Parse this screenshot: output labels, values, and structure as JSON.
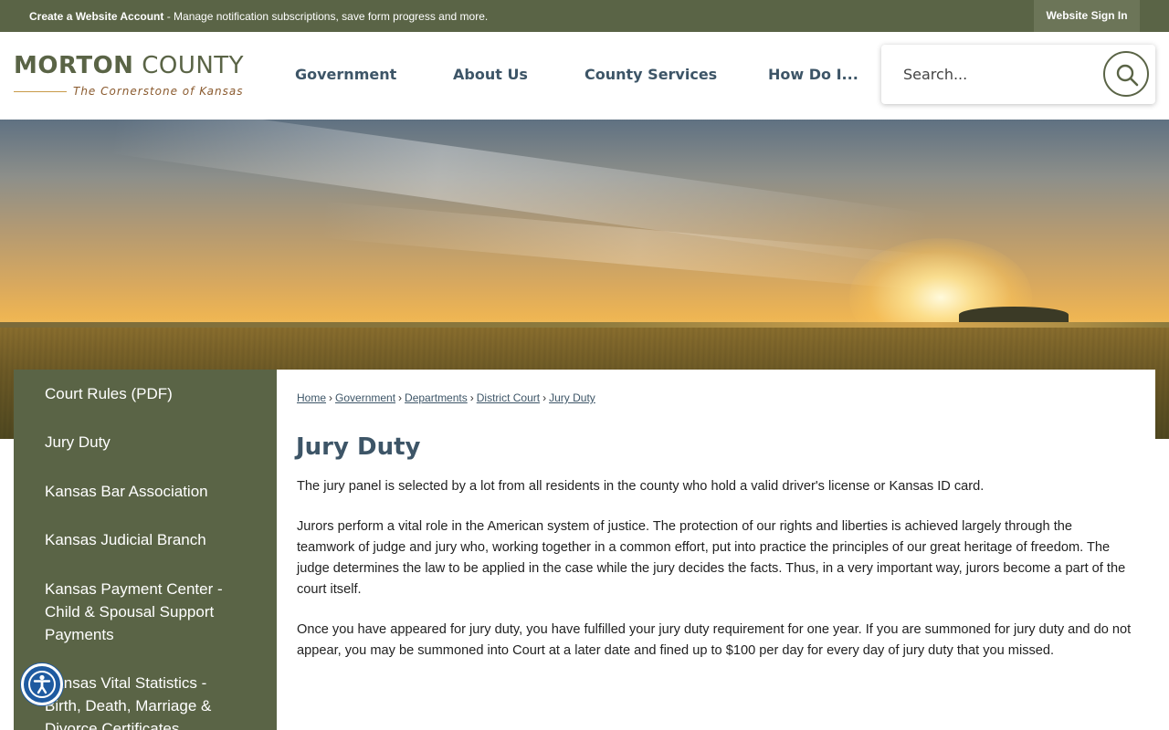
{
  "topbar": {
    "create_account_link": "Create a Website Account",
    "message": " - Manage notification subscriptions, save form progress and more.",
    "sign_in": "Website Sign In"
  },
  "header": {
    "logo_bold": "MORTON",
    "logo_rest": " COUNTY",
    "logo_tagline": "The Cornerstone of Kansas",
    "nav": [
      "Government",
      "About Us",
      "County Services",
      "How Do I..."
    ],
    "search_placeholder": "Search..."
  },
  "sidebar": {
    "items": [
      "Court Rules (PDF)",
      "Jury Duty",
      "Kansas Bar Association",
      "Kansas Judicial Branch",
      "Kansas Payment Center - Child & Spousal Support Payments",
      "Kansas Vital Statistics - Birth, Death, Marriage & Divorce Certificates"
    ]
  },
  "breadcrumb": [
    "Home",
    "Government",
    "Departments",
    "District Court",
    "Jury Duty"
  ],
  "main": {
    "title": "Jury Duty",
    "paragraphs": [
      "The jury panel is selected by a lot from all residents in the county who hold a valid driver's license or Kansas ID card.",
      "Jurors perform a vital role in the American system of justice. The protection of our rights and liberties is achieved largely through the teamwork of judge and jury who, working together in a common effort, put into practice the principles of our great heritage of freedom. The judge determines the law to be applied in the case while the jury decides the facts. Thus, in a very important way, jurors become a part of the court itself.",
      "Once you have appeared for jury duty, you have fulfilled your jury duty requirement for one year. If you are summoned for jury duty and do not appear, you may be summoned into Court at a later date and fined up to $100 per day for every day of jury duty that you missed."
    ]
  },
  "colors": {
    "brand_green": "#5a6446",
    "heading_blue": "#3d5567",
    "accessibility_blue": "#1e5aa0"
  },
  "icons": {
    "search": "search-icon",
    "accessibility": "accessibility-icon"
  }
}
